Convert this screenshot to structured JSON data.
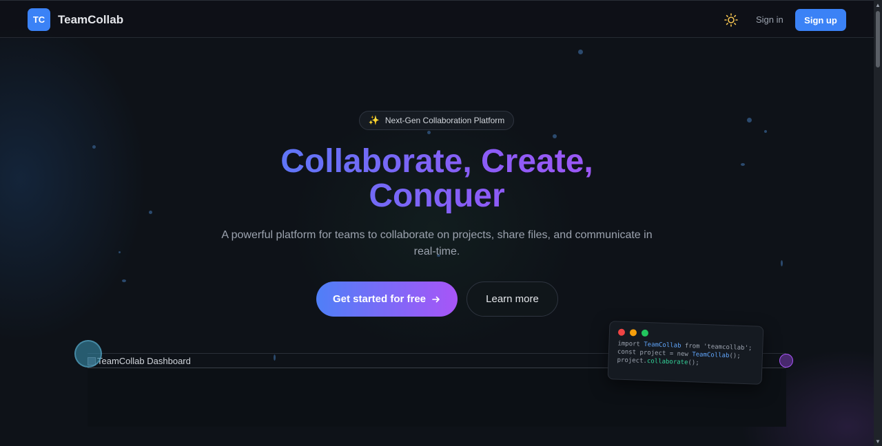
{
  "header": {
    "logo_initials": "TC",
    "brand_name": "TeamCollab",
    "theme_toggle_icon": "sun-icon",
    "signin_label": "Sign in",
    "signup_label": "Sign up"
  },
  "hero": {
    "badge_icon": "sparkles-icon",
    "badge_text": "Next-Gen Collaboration Platform",
    "headline_line1": "Collaborate, Create,",
    "headline_line2": "Conquer",
    "subtitle": "A powerful platform for teams to collaborate on projects, share files, and communicate in real-time.",
    "cta_primary_label": "Get started for free",
    "cta_primary_icon": "arrow-right-icon",
    "cta_secondary_label": "Learn more"
  },
  "preview": {
    "image_alt": "TeamCollab Dashboard"
  },
  "code_card": {
    "line1_a": "import ",
    "line1_b": "TeamCollab",
    "line1_c": " from 'teamcollab';",
    "line2_a": "const project = new ",
    "line2_b": "TeamCollab",
    "line2_c": "();",
    "line3_a": "project.",
    "line3_b": "collaborate",
    "line3_c": "();"
  },
  "colors": {
    "accent": "#3b82f6",
    "gradient_start": "#4f7ff7",
    "gradient_end": "#a855f7",
    "background": "#0e1218",
    "window_red": "#ef4444",
    "window_yellow": "#f59e0b",
    "window_green": "#22c55e"
  }
}
